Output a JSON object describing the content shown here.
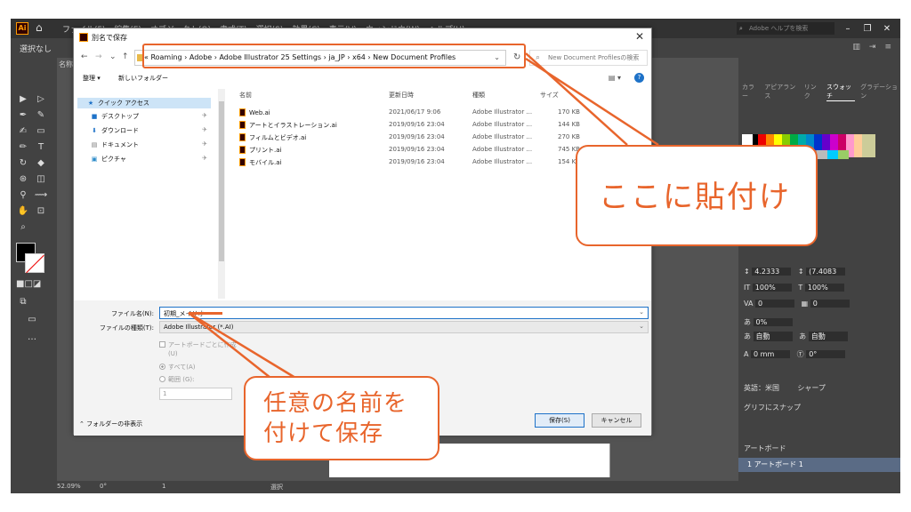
{
  "app": {
    "logo": "Ai",
    "menu": [
      "ファイル(F)",
      "編集(E)",
      "オブジェクト(O)",
      "書式(T)",
      "選択(S)",
      "効果(C)",
      "表示(V)",
      "ウィンドウ(W)",
      "ヘルプ(H)"
    ],
    "help_search_placeholder": "Adobe ヘルプを検索",
    "selection_label": "選択なし",
    "tab_name": "名称",
    "status": {
      "zoom": "52.09%",
      "rotation": "0°",
      "page": "1",
      "selection": "選択"
    }
  },
  "panel": {
    "tabs": [
      "カラー",
      "アピアランス",
      "リンク",
      "スウォッチ",
      "グラデーション"
    ],
    "active_tab": "スウォッチ",
    "rows": [
      {
        "left": "4.2333",
        "right": "(7.4083"
      },
      {
        "left": "100%",
        "right": "100%"
      },
      {
        "left": "0",
        "right": "0"
      },
      {
        "left": "0%",
        "right": ""
      },
      {
        "left": "自動",
        "right": "自動"
      },
      {
        "left": "0 mm",
        "right": "0°"
      }
    ],
    "language": "英語：米国",
    "antialias": "シャープ",
    "snap_label": "グリフにスナップ",
    "artboards_label": "アートボード",
    "artboard_item": "1    アートボード 1"
  },
  "dialog": {
    "title": "別名で保存",
    "close": "✕",
    "breadcrumb": "« Roaming  ›  Adobe  ›  Adobe Illustrator 25 Settings  ›  ja_JP  ›  x64  ›  New Document Profiles",
    "search_placeholder": "New Document Profilesの検索",
    "cmd_organize": "整理 ▾",
    "cmd_new_folder": "新しいフォルダー",
    "nav": {
      "quick_access": "クイック アクセス",
      "items": [
        "デスクトップ",
        "ダウンロード",
        "ドキュメント",
        "ピクチャ"
      ]
    },
    "columns": {
      "name": "名前",
      "date": "更新日時",
      "type": "種類",
      "size": "サイズ"
    },
    "files": [
      {
        "name": "Web.ai",
        "date": "2021/06/17 9:06",
        "type": "Adobe Illustrator ...",
        "size": "170 KB"
      },
      {
        "name": "アートとイラストレーション.ai",
        "date": "2019/09/16 23:04",
        "type": "Adobe Illustrator ...",
        "size": "144 KB"
      },
      {
        "name": "フィルムとビデオ.ai",
        "date": "2019/09/16 23:04",
        "type": "Adobe Illustrator ...",
        "size": "270 KB"
      },
      {
        "name": "プリント.ai",
        "date": "2019/09/16 23:04",
        "type": "Adobe Illustrator ...",
        "size": "745 KB"
      },
      {
        "name": "モバイル.ai",
        "date": "2019/09/16 23:04",
        "type": "Adobe Illustrator ...",
        "size": "154 KB"
      }
    ],
    "filename_label": "ファイル名(N):",
    "filename_value": "初期_メイリオ",
    "filetype_label": "ファイルの種類(T):",
    "filetype_value": "Adobe Illustrator (*.AI)",
    "opt_per_artboard": "アートボードごとに作成",
    "opt_per_artboard_2": "(U)",
    "opt_all": "すべて(A)",
    "opt_range": "範囲 (G):",
    "range_value": "1",
    "hide_folders": "フォルダーの非表示",
    "save_button": "保存(S)",
    "cancel_button": "キャンセル"
  },
  "annotations": {
    "callout_paste": "ここに貼付け",
    "callout_name_line1": "任意の名前を",
    "callout_name_line2": "付けて保存",
    "color": "#e8652c"
  }
}
